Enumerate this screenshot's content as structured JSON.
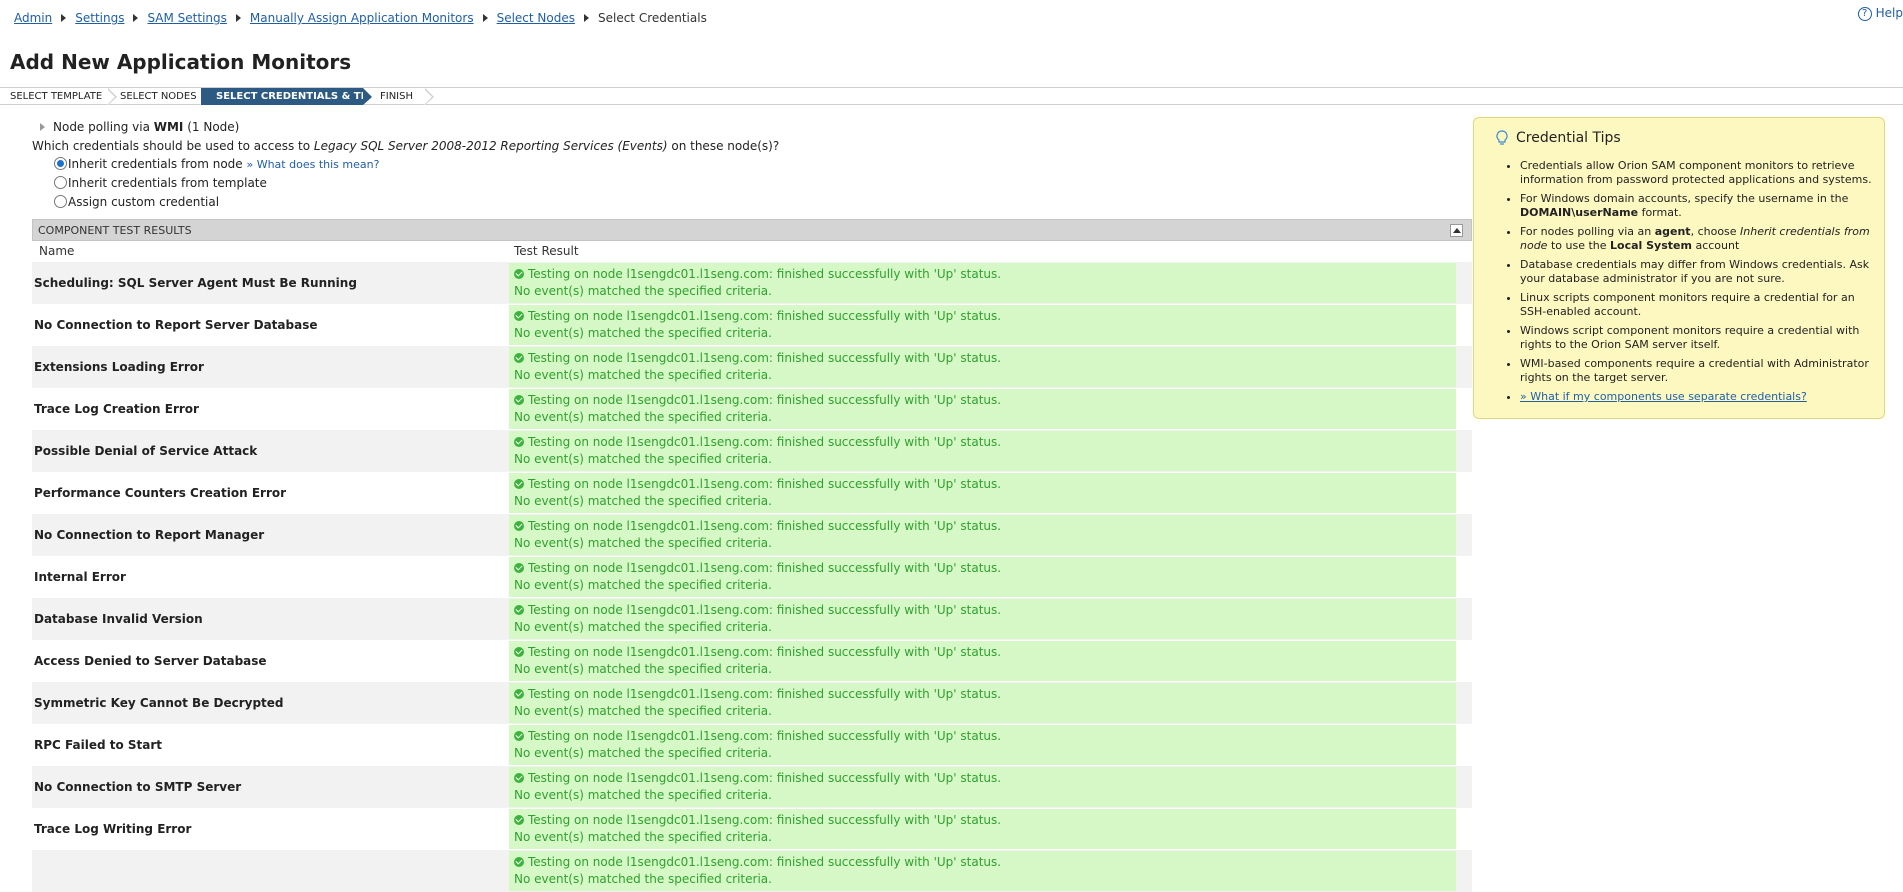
{
  "breadcrumb": {
    "items": [
      "Admin",
      "Settings",
      "SAM Settings",
      "Manually Assign Application Monitors",
      "Select Nodes"
    ],
    "current": "Select Credentials"
  },
  "help_label": "Help",
  "page_title": "Add New Application Monitors",
  "wizard": {
    "steps": [
      "SELECT TEMPLATE",
      "SELECT NODES",
      "SELECT CREDENTIALS & TEST",
      "FINISH"
    ],
    "active_index": 2
  },
  "node_polling": {
    "prefix": "Node polling via",
    "method": "WMI",
    "count": "(1 Node)"
  },
  "question": {
    "prefix": "Which credentials should be used to access to",
    "template": "Legacy SQL Server 2008-2012 Reporting Services (Events)",
    "suffix": "on these node(s)?"
  },
  "credential_options": [
    {
      "label": "Inherit credentials from node",
      "checked": true,
      "help_link": "» What does this mean?"
    },
    {
      "label": "Inherit credentials from template",
      "checked": false
    },
    {
      "label": "Assign custom credential",
      "checked": false
    }
  ],
  "results": {
    "header": "COMPONENT TEST RESULTS",
    "columns": [
      "Name",
      "Test Result"
    ],
    "result_line1": "Testing on node l1sengdc01.l1seng.com: finished successfully with 'Up' status.",
    "result_line2": "No event(s) matched the specified criteria.",
    "rows": [
      "Scheduling: SQL Server Agent Must Be Running",
      "No Connection to Report Server Database",
      "Extensions Loading Error",
      "Trace Log Creation Error",
      "Possible Denial of Service Attack",
      "Performance Counters Creation Error",
      "No Connection to Report Manager",
      "Internal Error",
      "Database Invalid Version",
      "Access Denied to Server Database",
      "Symmetric Key Cannot Be Decrypted",
      "RPC Failed to Start",
      "No Connection to SMTP Server",
      "Trace Log Writing Error",
      ""
    ]
  },
  "tips": {
    "title": "Credential Tips",
    "items": [
      [
        {
          "t": "Credentials allow Orion SAM component monitors to retrieve information from password protected applications and systems."
        }
      ],
      [
        {
          "t": "For Windows domain accounts, specify the username in the "
        },
        {
          "t": "DOMAIN\\userName",
          "b": true
        },
        {
          "t": " format."
        }
      ],
      [
        {
          "t": "For nodes polling via an "
        },
        {
          "t": "agent",
          "b": true
        },
        {
          "t": ", choose "
        },
        {
          "t": "Inherit credentials from node",
          "i": true
        },
        {
          "t": " to use the "
        },
        {
          "t": "Local System",
          "b": true
        },
        {
          "t": " account"
        }
      ],
      [
        {
          "t": "Database credentials may differ from Windows credentials. Ask your database administrator if you are not sure."
        }
      ],
      [
        {
          "t": "Linux scripts component monitors require a credential for an SSH-enabled account."
        }
      ],
      [
        {
          "t": "Windows script component monitors require a credential with rights to the Orion SAM server itself."
        }
      ],
      [
        {
          "t": "WMI-based components require a credential with Administrator rights on the target server."
        }
      ],
      [
        {
          "t": "» What if my components use separate credentials?",
          "link": true
        }
      ]
    ]
  }
}
